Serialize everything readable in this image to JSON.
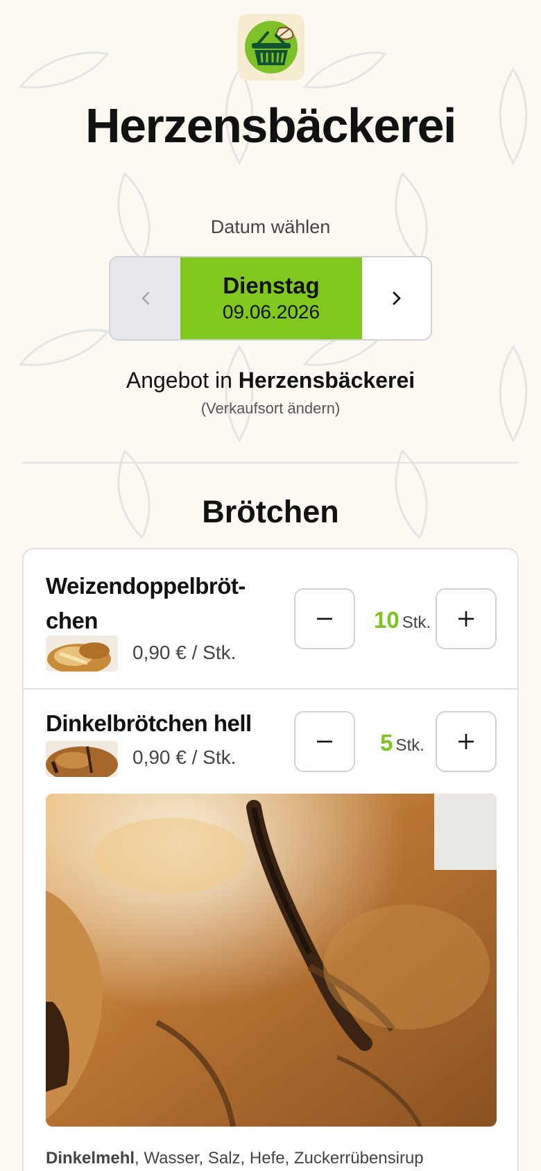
{
  "header": {
    "logo_icon": "basket-leaf-icon",
    "title": "Herzensbäckerei"
  },
  "date_select": {
    "label": "Datum wählen",
    "prev_icon": "chevron-left-icon",
    "next_icon": "chevron-right-icon",
    "day": "Dienstag",
    "date": "09.06.2026"
  },
  "location": {
    "prefix": "Angebot in",
    "name": "Herzensbäckerei",
    "change_link": "(Verkaufsort ändern)"
  },
  "section": {
    "title": "Brötchen"
  },
  "products": [
    {
      "name": "Weizendoppelbröt-chen",
      "price": "0,90 € / Stk.",
      "quantity": "10",
      "unit": "Stk."
    },
    {
      "name": "Dinkelbrötchen hell",
      "price": "0,90 € / Stk.",
      "quantity": "5",
      "unit": "Stk.",
      "ingredients_bold": "Dinkelmehl",
      "ingredients_rest": ", Wasser, Salz, Hefe, Zuckerrübensirup"
    }
  ],
  "colors": {
    "accent": "#80c81e",
    "quantity": "#7cc31a",
    "background": "#fcf8f2"
  }
}
